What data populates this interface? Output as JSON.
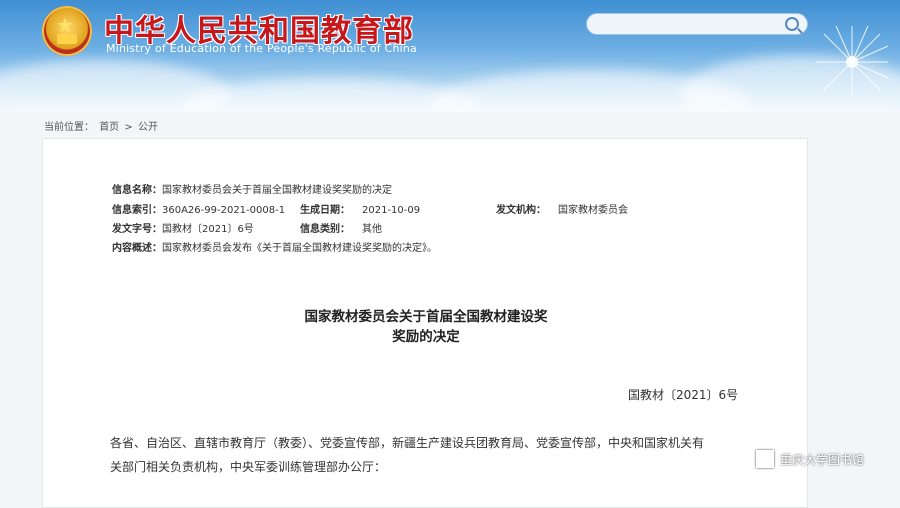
{
  "header": {
    "title_cn": "中华人民共和国教育部",
    "title_en": "Ministry of Education of the People's Republic of China",
    "emblem_icon": "national-emblem-icon",
    "search": {
      "placeholder": "",
      "icon": "search-icon"
    }
  },
  "breadcrumb": {
    "label": "当前位置：",
    "items": [
      "首页",
      "公开"
    ],
    "separator": ">"
  },
  "meta": {
    "name_label": "信息名称：",
    "name_value": "国家教材委员会关于首届全国教材建设奖奖励的决定",
    "index_label": "信息索引：",
    "index_value": "360A26-99-2021-0008-1",
    "date_label": "生成日期：",
    "date_value": "2021-10-09",
    "org_label": "发文机构：",
    "org_value": "国家教材委员会",
    "docno_label": "发文字号：",
    "docno_value": "国教材〔2021〕6号",
    "category_label": "信息类别：",
    "category_value": "其他",
    "summary_label": "内容概述：",
    "summary_value": "国家教材委员会发布《关于首届全国教材建设奖奖励的决定》。"
  },
  "document": {
    "title_line1": "国家教材委员会关于首届全国教材建设奖",
    "title_line2": "奖励的决定",
    "doc_number": "国教材〔2021〕6号",
    "para1_line1": "各省、自治区、直辖市教育厅（教委）、党委宣传部，新疆生产建设兵团教育局、党委宣传部，中央和国家机关有",
    "para1_line2": "关部门相关负责机构，中央军委训练管理部办公厅："
  },
  "watermark": {
    "text": "重庆大学图书馆"
  },
  "colors": {
    "title_red": "#c8171b",
    "header_blue": "#3f8fd3"
  }
}
